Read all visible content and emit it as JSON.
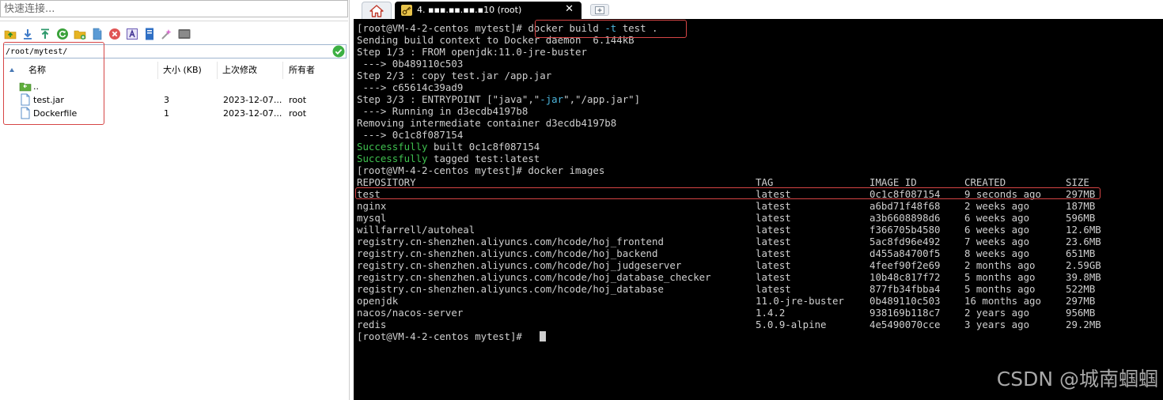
{
  "left_pane": {
    "quick_connect_placeholder": "快速连接...",
    "toolbar_icons": [
      "upload-folder-icon",
      "download-icon",
      "upload-icon",
      "refresh-icon",
      "new-folder-icon",
      "new-file-icon",
      "delete-icon",
      "rename-icon",
      "properties-icon",
      "tools-icon",
      "terminal-icon"
    ],
    "path": "/root/mytest/",
    "columns": {
      "name": "名称",
      "size": "大小 (KB)",
      "modified": "上次修改",
      "owner": "所有者"
    },
    "files": [
      {
        "name": "..",
        "size": "",
        "modified": "",
        "owner": "",
        "icon": "parent-folder-icon"
      },
      {
        "name": "test.jar",
        "size": "3",
        "modified": "2023-12-07...",
        "owner": "root",
        "icon": "file-icon"
      },
      {
        "name": "Dockerfile",
        "size": "1",
        "modified": "2023-12-07...",
        "owner": "root",
        "icon": "file-icon"
      }
    ]
  },
  "tabs": {
    "home_icon": "home-icon",
    "session_label": "4. ▪▪▪.▪▪.▪▪.▪10 (root)",
    "close_label": "✕",
    "new_tab_icon": "plus-icon"
  },
  "terminal": {
    "prompt": "[root@VM-4-2-centos mytest]# ",
    "build_cmd": {
      "pre": "docker build ",
      "flag": "-t",
      "post": " test ."
    },
    "lines": [
      "Sending build context to Docker daemon  6.144kB",
      "Step 1/3 : FROM openjdk:11.0-jre-buster",
      " ---> 0b489110c503",
      "Step 2/3 : copy test.jar /app.jar",
      " ---> c65614c39ad9"
    ],
    "entrypoint": {
      "pre": "Step 3/3 : ENTRYPOINT [\"java\",\"",
      "flag": "-jar",
      "post": "\",\"/app.jar\"]"
    },
    "lines2": [
      " ---> Running in d3ecdb4197b8",
      "Removing intermediate container d3ecdb4197b8",
      " ---> 0c1c8f087154"
    ],
    "success_built": {
      "label": "Successfully",
      "rest": " built 0c1c8f087154"
    },
    "success_tagged": {
      "label": "Successfully",
      "rest": " tagged test:latest"
    },
    "images_cmd": "docker images",
    "images_header": {
      "repository": "REPOSITORY",
      "tag": "TAG",
      "image_id": "IMAGE ID",
      "created": "CREATED",
      "size": "SIZE"
    },
    "images": [
      {
        "repository": "test",
        "tag": "latest",
        "image_id": "0c1c8f087154",
        "created": "9 seconds ago",
        "size": "297MB"
      },
      {
        "repository": "nginx",
        "tag": "latest",
        "image_id": "a6bd71f48f68",
        "created": "2 weeks ago",
        "size": "187MB"
      },
      {
        "repository": "mysql",
        "tag": "latest",
        "image_id": "a3b6608898d6",
        "created": "6 weeks ago",
        "size": "596MB"
      },
      {
        "repository": "willfarrell/autoheal",
        "tag": "latest",
        "image_id": "f366705b4580",
        "created": "6 weeks ago",
        "size": "12.6MB"
      },
      {
        "repository": "registry.cn-shenzhen.aliyuncs.com/hcode/hoj_frontend",
        "tag": "latest",
        "image_id": "5ac8fd96e492",
        "created": "7 weeks ago",
        "size": "23.6MB"
      },
      {
        "repository": "registry.cn-shenzhen.aliyuncs.com/hcode/hoj_backend",
        "tag": "latest",
        "image_id": "d455a84700f5",
        "created": "8 weeks ago",
        "size": "651MB"
      },
      {
        "repository": "registry.cn-shenzhen.aliyuncs.com/hcode/hoj_judgeserver",
        "tag": "latest",
        "image_id": "4feef90f2e69",
        "created": "2 months ago",
        "size": "2.59GB"
      },
      {
        "repository": "registry.cn-shenzhen.aliyuncs.com/hcode/hoj_database_checker",
        "tag": "latest",
        "image_id": "10b48c817f72",
        "created": "5 months ago",
        "size": "39.8MB"
      },
      {
        "repository": "registry.cn-shenzhen.aliyuncs.com/hcode/hoj_database",
        "tag": "latest",
        "image_id": "877fb34fbba4",
        "created": "5 months ago",
        "size": "522MB"
      },
      {
        "repository": "openjdk",
        "tag": "11.0-jre-buster",
        "image_id": "0b489110c503",
        "created": "16 months ago",
        "size": "297MB"
      },
      {
        "repository": "nacos/nacos-server",
        "tag": "1.4.2",
        "image_id": "938169b118c7",
        "created": "2 years ago",
        "size": "956MB"
      },
      {
        "repository": "redis",
        "tag": "5.0.9-alpine",
        "image_id": "4e5490070cce",
        "created": "3 years ago",
        "size": "29.2MB"
      }
    ]
  },
  "watermark": "CSDN @城南蝈蝈",
  "colors": {
    "terminal_bg": "#000000",
    "terminal_fg": "#cfcfcf",
    "success_green": "#3fc04f",
    "flag_cyan": "#4cb6dd",
    "highlight_red": "#d64545"
  }
}
